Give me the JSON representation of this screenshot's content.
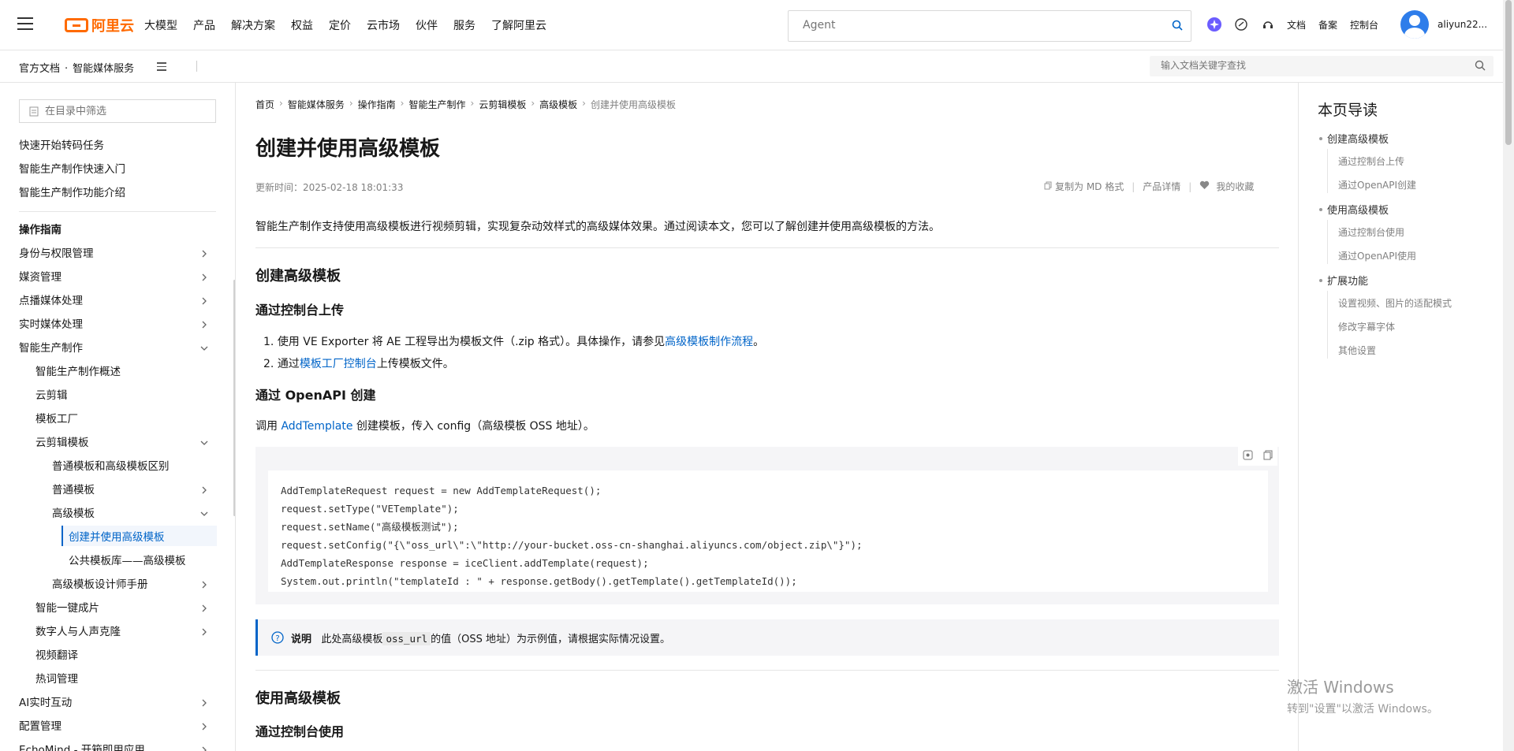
{
  "header": {
    "logo_text": "阿里云",
    "menu": [
      "大模型",
      "产品",
      "解决方案",
      "权益",
      "定价",
      "云市场",
      "伙伴",
      "服务",
      "了解阿里云"
    ],
    "search_placeholder": "Agent",
    "links": [
      "文档",
      "备案",
      "控制台"
    ],
    "username": "aliyun22..."
  },
  "subbar": {
    "doc_root": "官方文档",
    "dot": "·",
    "product": "智能媒体服务",
    "search_placeholder": "输入文档关键字查找"
  },
  "sidebar": {
    "filter_placeholder": "在目录中筛选",
    "top_items": [
      "快速开始转码任务",
      "智能生产制作快速入门",
      "智能生产制作功能介绍"
    ],
    "section_title": "操作指南",
    "items": [
      {
        "label": "身份与权限管理",
        "chevron": "right"
      },
      {
        "label": "媒资管理",
        "chevron": "right"
      },
      {
        "label": "点播媒体处理",
        "chevron": "right"
      },
      {
        "label": "实时媒体处理",
        "chevron": "right"
      },
      {
        "label": "智能生产制作",
        "chevron": "down"
      },
      {
        "label": "智能生产制作概述",
        "chevron": ""
      },
      {
        "label": "云剪辑",
        "chevron": ""
      },
      {
        "label": "模板工厂",
        "chevron": ""
      },
      {
        "label": "云剪辑模板",
        "chevron": "down"
      },
      {
        "label": "普通模板和高级模板区别",
        "chevron": ""
      },
      {
        "label": "普通模板",
        "chevron": "right"
      },
      {
        "label": "高级模板",
        "chevron": "down"
      },
      {
        "label": "创建并使用高级模板",
        "chevron": ""
      },
      {
        "label": "公共模板库——高级模板",
        "chevron": ""
      },
      {
        "label": "高级模板设计师手册",
        "chevron": "right"
      },
      {
        "label": "智能一键成片",
        "chevron": "right"
      },
      {
        "label": "数字人与人声克隆",
        "chevron": "right"
      },
      {
        "label": "视频翻译",
        "chevron": ""
      },
      {
        "label": "热词管理",
        "chevron": ""
      },
      {
        "label": "AI实时互动",
        "chevron": "right"
      },
      {
        "label": "配置管理",
        "chevron": "right"
      },
      {
        "label": "EchoMind - 开箱即用应用",
        "chevron": "right"
      }
    ]
  },
  "content": {
    "breadcrumb": [
      "首页",
      "智能媒体服务",
      "操作指南",
      "智能生产制作",
      "云剪辑模板",
      "高级模板",
      "创建并使用高级模板"
    ],
    "breadcrumb_sep": "›",
    "title": "创建并使用高级模板",
    "updated": "更新时间：2025-02-18 18:01:33",
    "tools": [
      "复制为 MD 格式",
      "产品详情",
      "我的收藏"
    ],
    "intro": "智能生产制作支持使用高级模板进行视频剪辑，实现复杂动效样式的高级媒体效果。通过阅读本文，您可以了解创建并使用高级模板的方法。",
    "h2_create": "创建高级模板",
    "h3_console_upload": "通过控制台上传",
    "step1_pre": "使用 VE Exporter 将 AE 工程导出为模板文件（.zip 格式）。具体操作，请参见",
    "step1_link": "高级模板制作流程",
    "step1_post": "。",
    "step2_pre": "通过",
    "step2_link": "模板工厂控制台",
    "step2_post": "上传模板文件。",
    "h3_openapi": "通过 OpenAPI 创建",
    "api_pre": "调用 ",
    "api_link": "AddTemplate",
    "api_post": " 创建模板，传入 config（高级模板 OSS 地址）。",
    "code_lines": [
      "AddTemplateRequest request = new AddTemplateRequest();",
      "request.setType(\"VETemplate\");",
      "request.setName(\"高级模板测试\");",
      "request.setConfig(\"{\\\"oss_url\\\":\\\"http://your-bucket.oss-cn-shanghai.aliyuncs.com/object.zip\\\"}\");",
      "AddTemplateResponse response = iceClient.addTemplate(request);",
      "System.out.println(\"templateId : \" + response.getBody().getTemplate().getTemplateId());"
    ],
    "note_label": "说明",
    "note_pre": "此处高级模板",
    "note_code": "oss_url",
    "note_post": "的值（OSS 地址）为示例值，请根据实际情况设置。",
    "h2_use": "使用高级模板",
    "h3_console_use": "通过控制台使用"
  },
  "toc": {
    "title": "本页导读",
    "groups": [
      {
        "label": "创建高级模板",
        "subs": [
          "通过控制台上传",
          "通过OpenAPI创建"
        ]
      },
      {
        "label": "使用高级模板",
        "subs": [
          "通过控制台使用",
          "通过OpenAPI使用"
        ]
      },
      {
        "label": "扩展功能",
        "subs": [
          "设置视频、图片的适配模式",
          "修改字幕字体",
          "其他设置"
        ]
      }
    ]
  },
  "watermark": {
    "line1": "激活 Windows",
    "line2": "转到\"设置\"以激活 Windows。"
  },
  "colors": {
    "accent": "#0064c8",
    "brand": "#ff6a00"
  }
}
